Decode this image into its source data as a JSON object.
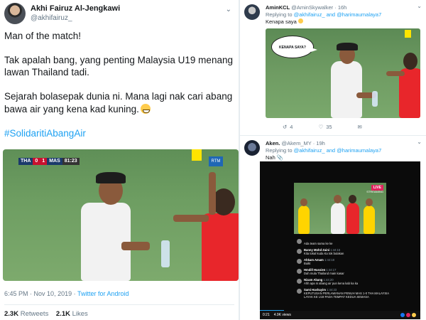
{
  "main_tweet": {
    "name": "Akhi Fairuz Al-Jengkawi",
    "handle": "@akhifairuz_",
    "paragraphs": [
      "Man of the match!",
      "Tak apalah bang, yang penting Malaysia U19 menang lawan Thailand tadi.",
      "Sejarah bolasepak dunia ni. Mana lagi nak cari abang bawa air yang kena kad kuning."
    ],
    "emoji": "grinning-sweat-emoji",
    "hashtag": "#SolidaritiAbangAir",
    "scorebug": {
      "team_a": "THA",
      "score_a": "0",
      "score_b": "1",
      "team_b": "MAS",
      "clock": "81:23"
    },
    "broadcaster": "RTM",
    "time": "6:45 PM",
    "date": "Nov 10, 2019",
    "source": "Twitter for Android",
    "retweets": "2.3K",
    "retweets_label": "Retweets",
    "likes": "2.1K",
    "likes_label": "Likes"
  },
  "reply1": {
    "name": "AminKCL",
    "handle": "@AminSkywalker",
    "age": "16h",
    "replying_to_label": "Replying to",
    "mentions": "@akhifairuz_ and @harimaumalaya7",
    "text": "Kenapa saya",
    "bubble_text": "KENAPA SAYA?",
    "retweets": "4",
    "likes": "35"
  },
  "reply2": {
    "name": "Aken.",
    "handle": "@Akem_MY",
    "age": "19h",
    "replying_to_label": "Replying to",
    "mentions": "@akhifairuz_ and @harimaumalaya7",
    "text": "Nah",
    "live_badge": "LIVE",
    "live_sub": "STREAMING",
    "video_time": "0:21",
    "views": "4.9K views",
    "progress": 0.15,
    "comments": [
      {
        "name": "",
        "time": "",
        "text": "Ada team sama ke ke"
      },
      {
        "name": "Banny Mohd Zaini",
        "time": "1:44:15",
        "text": "Kita tokal kuda Ka tok bulakan"
      },
      {
        "name": "Ahkam Amam",
        "time": "1:44:18",
        "text": "Buikt"
      },
      {
        "name": "Hmdill Hussien",
        "time": "1:44:17",
        "text": "Dah mula Thailand main kasar"
      },
      {
        "name": "Nizam Abang",
        "time": "1:44:20",
        "text": "Ahh apa ni abang air pun kena kab ka ka"
      },
      {
        "name": "Sami Hashayim",
        "time": "1:44:23",
        "text": "KEPUTUSAN PERLAWANAN PENUH MAS 1-0 THA MALAYSIA LAYAK KE U19 PADA TEMPAT KEDUA SEMASA"
      }
    ]
  },
  "colors": {
    "link": "#1da1f2",
    "muted": "#657786",
    "card_yellow": "#ffe400",
    "referee_red": "#e8262b",
    "pitch_green": "#6e9e62"
  }
}
